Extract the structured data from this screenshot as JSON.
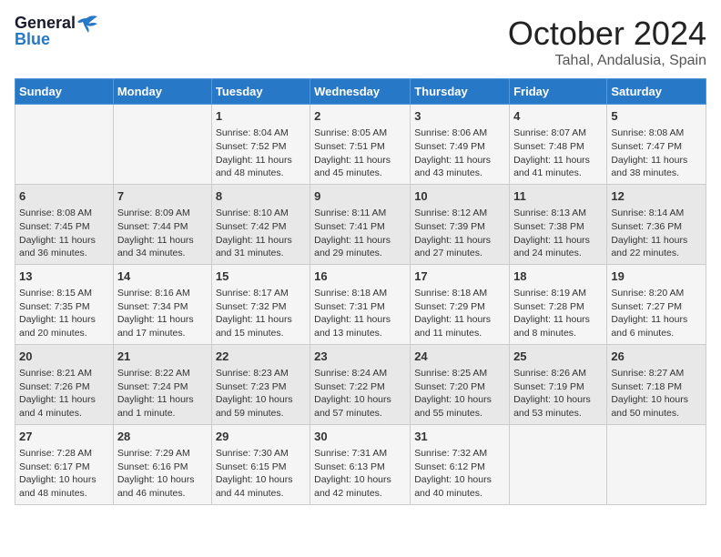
{
  "header": {
    "logo_line1": "General",
    "logo_line2": "Blue",
    "month": "October 2024",
    "location": "Tahal, Andalusia, Spain"
  },
  "days_of_week": [
    "Sunday",
    "Monday",
    "Tuesday",
    "Wednesday",
    "Thursday",
    "Friday",
    "Saturday"
  ],
  "weeks": [
    [
      {
        "day": "",
        "content": ""
      },
      {
        "day": "",
        "content": ""
      },
      {
        "day": "1",
        "content": "Sunrise: 8:04 AM\nSunset: 7:52 PM\nDaylight: 11 hours and 48 minutes."
      },
      {
        "day": "2",
        "content": "Sunrise: 8:05 AM\nSunset: 7:51 PM\nDaylight: 11 hours and 45 minutes."
      },
      {
        "day": "3",
        "content": "Sunrise: 8:06 AM\nSunset: 7:49 PM\nDaylight: 11 hours and 43 minutes."
      },
      {
        "day": "4",
        "content": "Sunrise: 8:07 AM\nSunset: 7:48 PM\nDaylight: 11 hours and 41 minutes."
      },
      {
        "day": "5",
        "content": "Sunrise: 8:08 AM\nSunset: 7:47 PM\nDaylight: 11 hours and 38 minutes."
      }
    ],
    [
      {
        "day": "6",
        "content": "Sunrise: 8:08 AM\nSunset: 7:45 PM\nDaylight: 11 hours and 36 minutes."
      },
      {
        "day": "7",
        "content": "Sunrise: 8:09 AM\nSunset: 7:44 PM\nDaylight: 11 hours and 34 minutes."
      },
      {
        "day": "8",
        "content": "Sunrise: 8:10 AM\nSunset: 7:42 PM\nDaylight: 11 hours and 31 minutes."
      },
      {
        "day": "9",
        "content": "Sunrise: 8:11 AM\nSunset: 7:41 PM\nDaylight: 11 hours and 29 minutes."
      },
      {
        "day": "10",
        "content": "Sunrise: 8:12 AM\nSunset: 7:39 PM\nDaylight: 11 hours and 27 minutes."
      },
      {
        "day": "11",
        "content": "Sunrise: 8:13 AM\nSunset: 7:38 PM\nDaylight: 11 hours and 24 minutes."
      },
      {
        "day": "12",
        "content": "Sunrise: 8:14 AM\nSunset: 7:36 PM\nDaylight: 11 hours and 22 minutes."
      }
    ],
    [
      {
        "day": "13",
        "content": "Sunrise: 8:15 AM\nSunset: 7:35 PM\nDaylight: 11 hours and 20 minutes."
      },
      {
        "day": "14",
        "content": "Sunrise: 8:16 AM\nSunset: 7:34 PM\nDaylight: 11 hours and 17 minutes."
      },
      {
        "day": "15",
        "content": "Sunrise: 8:17 AM\nSunset: 7:32 PM\nDaylight: 11 hours and 15 minutes."
      },
      {
        "day": "16",
        "content": "Sunrise: 8:18 AM\nSunset: 7:31 PM\nDaylight: 11 hours and 13 minutes."
      },
      {
        "day": "17",
        "content": "Sunrise: 8:18 AM\nSunset: 7:29 PM\nDaylight: 11 hours and 11 minutes."
      },
      {
        "day": "18",
        "content": "Sunrise: 8:19 AM\nSunset: 7:28 PM\nDaylight: 11 hours and 8 minutes."
      },
      {
        "day": "19",
        "content": "Sunrise: 8:20 AM\nSunset: 7:27 PM\nDaylight: 11 hours and 6 minutes."
      }
    ],
    [
      {
        "day": "20",
        "content": "Sunrise: 8:21 AM\nSunset: 7:26 PM\nDaylight: 11 hours and 4 minutes."
      },
      {
        "day": "21",
        "content": "Sunrise: 8:22 AM\nSunset: 7:24 PM\nDaylight: 11 hours and 1 minute."
      },
      {
        "day": "22",
        "content": "Sunrise: 8:23 AM\nSunset: 7:23 PM\nDaylight: 10 hours and 59 minutes."
      },
      {
        "day": "23",
        "content": "Sunrise: 8:24 AM\nSunset: 7:22 PM\nDaylight: 10 hours and 57 minutes."
      },
      {
        "day": "24",
        "content": "Sunrise: 8:25 AM\nSunset: 7:20 PM\nDaylight: 10 hours and 55 minutes."
      },
      {
        "day": "25",
        "content": "Sunrise: 8:26 AM\nSunset: 7:19 PM\nDaylight: 10 hours and 53 minutes."
      },
      {
        "day": "26",
        "content": "Sunrise: 8:27 AM\nSunset: 7:18 PM\nDaylight: 10 hours and 50 minutes."
      }
    ],
    [
      {
        "day": "27",
        "content": "Sunrise: 7:28 AM\nSunset: 6:17 PM\nDaylight: 10 hours and 48 minutes."
      },
      {
        "day": "28",
        "content": "Sunrise: 7:29 AM\nSunset: 6:16 PM\nDaylight: 10 hours and 46 minutes."
      },
      {
        "day": "29",
        "content": "Sunrise: 7:30 AM\nSunset: 6:15 PM\nDaylight: 10 hours and 44 minutes."
      },
      {
        "day": "30",
        "content": "Sunrise: 7:31 AM\nSunset: 6:13 PM\nDaylight: 10 hours and 42 minutes."
      },
      {
        "day": "31",
        "content": "Sunrise: 7:32 AM\nSunset: 6:12 PM\nDaylight: 10 hours and 40 minutes."
      },
      {
        "day": "",
        "content": ""
      },
      {
        "day": "",
        "content": ""
      }
    ]
  ]
}
